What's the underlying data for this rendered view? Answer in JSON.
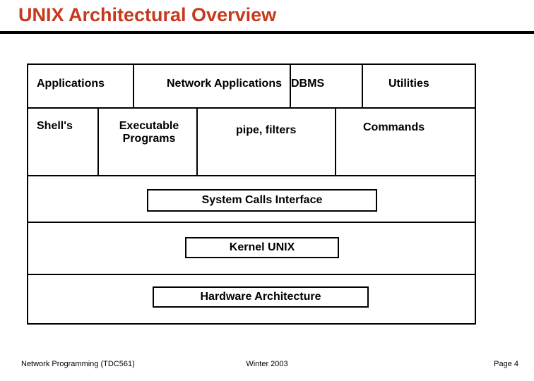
{
  "title": "UNIX Architectural Overview",
  "row1": {
    "applications": "Applications",
    "netapp": "Network Applications",
    "dbms": "DBMS",
    "utilities": "Utilities"
  },
  "row2": {
    "shells": "Shell's",
    "exec": "Executable Programs",
    "pipe": "pipe, filters",
    "commands": "Commands"
  },
  "syscalls": "System Calls Interface",
  "kernel": "Kernel UNIX",
  "hardware": "Hardware Architecture",
  "footer": {
    "left": "Network Programming (TDC561)",
    "center": "Winter  2003",
    "right": "Page 4"
  }
}
